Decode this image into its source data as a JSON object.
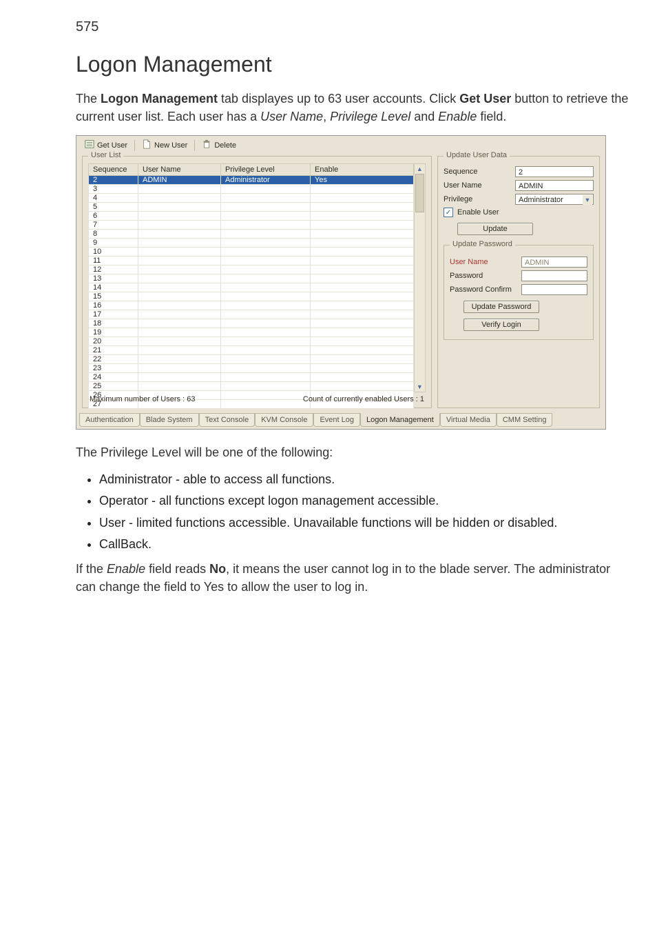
{
  "page_number": "575",
  "heading": "Logon Management",
  "intro": {
    "t1": "The ",
    "t2": "Logon Management",
    "t3": " tab displayes up to 63 user accounts. Click ",
    "t4": "Get User",
    "t5": " button to retrieve the current user list. Each user has a ",
    "t6": "User Name",
    "t7": ", ",
    "t8": "Privilege Level",
    "t9": " and ",
    "t10": "Enable",
    "t11": " field."
  },
  "toolbar": {
    "get_user": "Get User",
    "new_user": "New User",
    "delete": "Delete"
  },
  "user_list": {
    "legend": "User List",
    "headers": {
      "sequence": "Sequence",
      "user_name": "User Name",
      "privilege": "Privilege Level",
      "enable": "Enable"
    },
    "rows": [
      {
        "seq": "2",
        "name": "ADMIN",
        "priv": "Administrator",
        "enable": "Yes",
        "selected": true
      },
      {
        "seq": "3"
      },
      {
        "seq": "4"
      },
      {
        "seq": "5"
      },
      {
        "seq": "6"
      },
      {
        "seq": "7"
      },
      {
        "seq": "8"
      },
      {
        "seq": "9"
      },
      {
        "seq": "10"
      },
      {
        "seq": "11"
      },
      {
        "seq": "12"
      },
      {
        "seq": "13"
      },
      {
        "seq": "14"
      },
      {
        "seq": "15"
      },
      {
        "seq": "16"
      },
      {
        "seq": "17"
      },
      {
        "seq": "18"
      },
      {
        "seq": "19"
      },
      {
        "seq": "20"
      },
      {
        "seq": "21"
      },
      {
        "seq": "22"
      },
      {
        "seq": "23"
      },
      {
        "seq": "24"
      },
      {
        "seq": "25"
      },
      {
        "seq": "26"
      },
      {
        "seq": "27"
      }
    ],
    "max_users": "Maximum number of Users : 63",
    "count_enabled": "Count of currently enabled Users : 1"
  },
  "update_panel": {
    "legend": "Update User Data",
    "labels": {
      "sequence": "Sequence",
      "user_name": "User Name",
      "privilege": "Privilege",
      "enable_user": "Enable User",
      "update_btn": "Update"
    },
    "values": {
      "sequence": "2",
      "user_name": "ADMIN",
      "privilege": "Administrator"
    }
  },
  "update_password": {
    "legend": "Update Password",
    "labels": {
      "user_name": "User Name",
      "password": "Password",
      "password_confirm": "Password Confirm",
      "update_pw_btn": "Update Password",
      "verify_btn": "Verify Login"
    },
    "user_name_value": "ADMIN"
  },
  "tabs": [
    "Authentication",
    "Blade System",
    "Text Console",
    "KVM Console",
    "Event Log",
    "Logon Management",
    "Virtual Media",
    "CMM Setting"
  ],
  "active_tab_index": 5,
  "after_text": "The Privilege Level will be one of the following:",
  "bullets": [
    "Administrator - able to access all functions.",
    "Operator - all functions except logon management accessible.",
    "User - limited functions accessible. Unavailable functions will be hidden or disabled.",
    "CallBack."
  ],
  "closing": {
    "t1": "If the ",
    "t2": "Enable",
    "t3": " field reads ",
    "t4": "No",
    "t5": ", it means the user cannot log in to the blade server. The administrator can change the field to Yes to allow the user to log in."
  }
}
